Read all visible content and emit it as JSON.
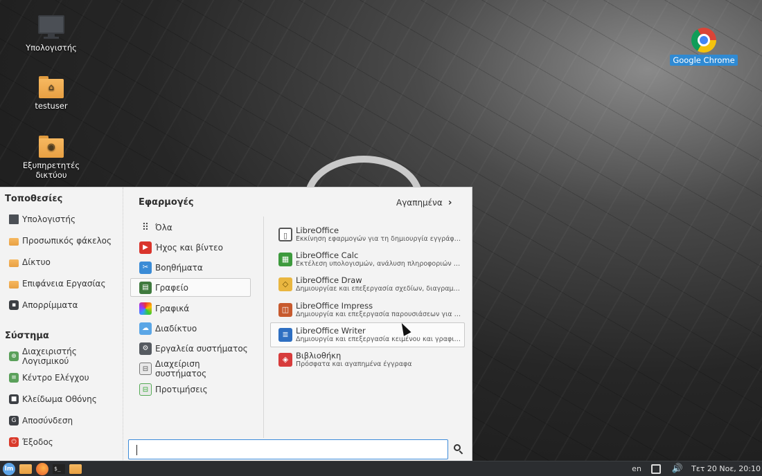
{
  "desktop": {
    "icons": [
      {
        "label": "Υπολογιστής",
        "icon": "computer-icon"
      },
      {
        "label": "testuser",
        "icon": "home-folder-icon"
      },
      {
        "label": "Εξυπηρετητές δικτύου",
        "icon": "network-folder-icon"
      },
      {
        "label": "Google Chrome",
        "icon": "chrome-icon"
      }
    ]
  },
  "menu": {
    "places_title": "Τοποθεσίες",
    "places": [
      {
        "label": "Υπολογιστής",
        "icon": "computer-icon"
      },
      {
        "label": "Προσωπικός φάκελος",
        "icon": "home-folder-icon"
      },
      {
        "label": "Δίκτυο",
        "icon": "network-icon"
      },
      {
        "label": "Επιφάνεια Εργασίας",
        "icon": "desktop-folder-icon"
      },
      {
        "label": "Απορρίμματα",
        "icon": "trash-icon"
      }
    ],
    "system_title": "Σύστημα",
    "system": [
      {
        "label": "Διαχειριστής Λογισμικού",
        "icon": "software-manager-icon"
      },
      {
        "label": "Κέντρο Ελέγχου",
        "icon": "control-center-icon"
      },
      {
        "label": "Κλείδωμα Οθόνης",
        "icon": "lock-icon"
      },
      {
        "label": "Αποσύνδεση",
        "icon": "logout-icon"
      },
      {
        "label": "Έξοδος",
        "icon": "power-icon"
      }
    ],
    "apps_title": "Εφαρμογές",
    "favorites_label": "Αγαπημένα",
    "categories": [
      {
        "label": "Όλα",
        "icon": "grid-icon"
      },
      {
        "label": "Ήχος και βίντεο",
        "icon": "multimedia-icon"
      },
      {
        "label": "Βοηθήματα",
        "icon": "accessories-icon"
      },
      {
        "label": "Γραφείο",
        "icon": "office-icon",
        "active": true
      },
      {
        "label": "Γραφικά",
        "icon": "graphics-icon"
      },
      {
        "label": "Διαδίκτυο",
        "icon": "internet-icon"
      },
      {
        "label": "Εργαλεία συστήματος",
        "icon": "system-tools-icon"
      },
      {
        "label": "Διαχείριση συστήματος",
        "icon": "administration-icon"
      },
      {
        "label": "Προτιμήσεις",
        "icon": "preferences-icon"
      }
    ],
    "apps": [
      {
        "name": "LibreOffice",
        "desc": "Εκκίνηση εφαρμογών για τη δημιουργία εγγράφων κ...",
        "icon": "libreoffice-icon"
      },
      {
        "name": "LibreOffice Calc",
        "desc": "Εκτέλεση υπολογισμών, ανάλυση πληροφοριών και ...",
        "icon": "calc-icon"
      },
      {
        "name": "LibreOffice Draw",
        "desc": "Δημιουργίαε και επεξεργασία σχεδίων, διαγραμμάτ...",
        "icon": "draw-icon"
      },
      {
        "name": "LibreOffice Impress",
        "desc": "Δημιουργία και επεξεργασία παρουσιάσεων για προ...",
        "icon": "impress-icon"
      },
      {
        "name": "LibreOffice Writer",
        "desc": "Δημιουργία και επεξεργασία κειμένου και γραφικών...",
        "icon": "writer-icon",
        "hover": true
      },
      {
        "name": "Βιβλιοθήκη",
        "desc": "Πρόσφατα και αγαπημένα έγγραφα",
        "icon": "library-icon"
      }
    ],
    "search": {
      "value": "",
      "placeholder": ""
    }
  },
  "taskbar": {
    "lang": "en",
    "clock": "Τετ 20 Νοε, 20:10",
    "terminal_glyph": "$_"
  }
}
